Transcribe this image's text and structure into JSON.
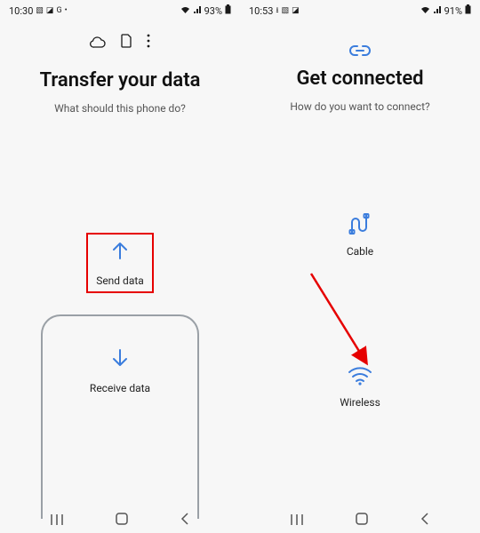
{
  "left": {
    "status": {
      "time": "10:30",
      "battery": "93%"
    },
    "title": "Transfer your data",
    "subtitle": "What should this phone do?",
    "send_label": "Send data",
    "receive_label": "Receive data"
  },
  "right": {
    "status": {
      "time": "10:53",
      "battery": "91%"
    },
    "title": "Get connected",
    "subtitle": "How do you want to connect?",
    "cable_label": "Cable",
    "wireless_label": "Wireless"
  },
  "colors": {
    "accent": "#3b7ddd",
    "highlight": "#e60000"
  }
}
